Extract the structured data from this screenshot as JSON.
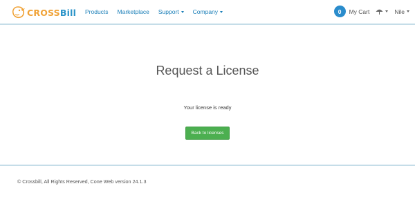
{
  "brand": {
    "text_part1": "CROSS",
    "text_part2": "Bill",
    "colors": {
      "orange": "#f0a236",
      "blue": "#2a93c8"
    }
  },
  "nav": {
    "items": [
      {
        "label": "Products",
        "has_menu": false
      },
      {
        "label": "Marketplace",
        "has_menu": false
      },
      {
        "label": "Support",
        "has_menu": true
      },
      {
        "label": "Company",
        "has_menu": true
      }
    ],
    "link_color": "#1b7fb8"
  },
  "account": {
    "cart_count": "0",
    "cart_label": "My Cart",
    "settings_icon": "umbrella-icon",
    "user_name": "Nile"
  },
  "main": {
    "title": "Request a License",
    "status": "Your license is ready",
    "button_label": "Back to licenses",
    "button_color": "#4caf50"
  },
  "footer": {
    "text": "© Crossbill, All Rights Reserved, Cone Web version 24.1.3"
  }
}
